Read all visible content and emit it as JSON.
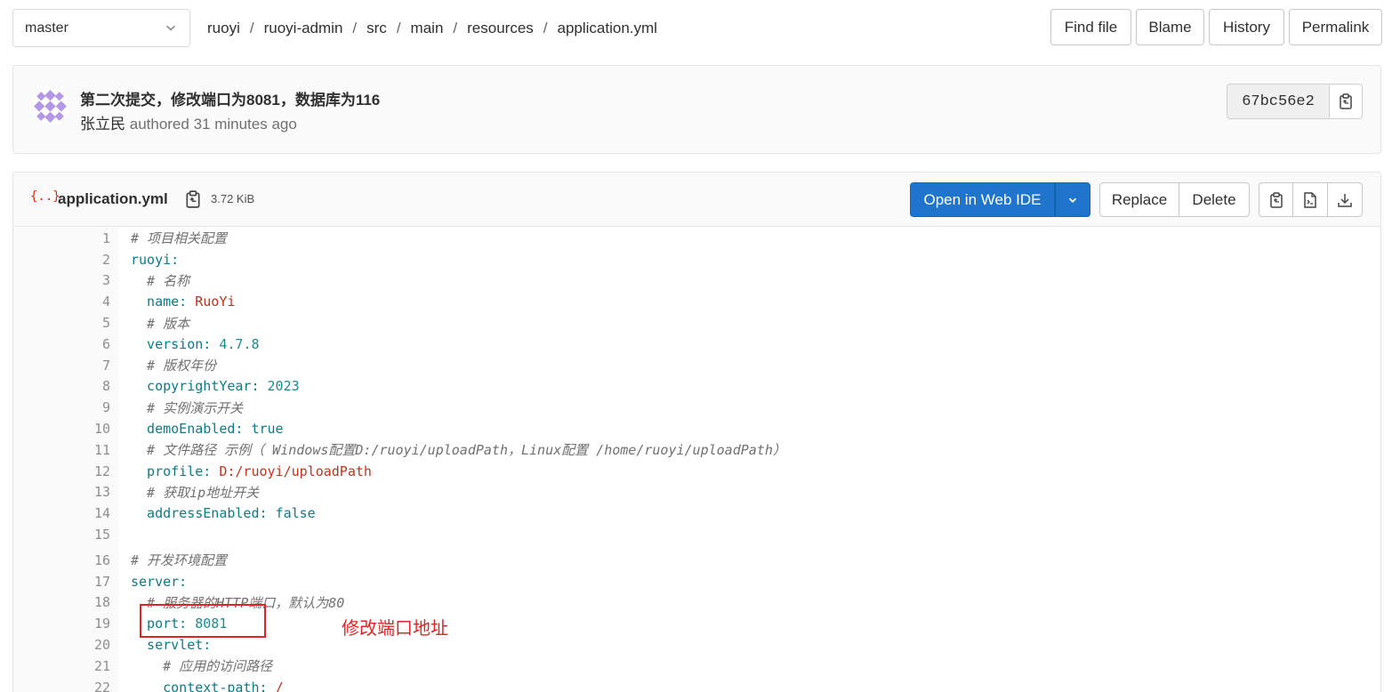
{
  "branch": {
    "value": "master"
  },
  "breadcrumb": [
    "ruoyi",
    "ruoyi-admin",
    "src",
    "main",
    "resources",
    "application.yml"
  ],
  "breadcrumb_sep": "/",
  "top_actions": {
    "find_file": "Find file",
    "blame": "Blame",
    "history": "History",
    "permalink": "Permalink"
  },
  "commit": {
    "title": "第二次提交，修改端口为8081，数据库为116",
    "author": "张立民",
    "meta": "authored 31 minutes ago",
    "sha": "67bc56e2"
  },
  "file": {
    "type_icon": "{..}",
    "name": "application.yml",
    "size": "3.72 KiB",
    "open_ide": "Open in Web IDE",
    "replace": "Replace",
    "delete": "Delete"
  },
  "code_lines": [
    {
      "n": "1",
      "text": "# 项目相关配置"
    },
    {
      "n": "2",
      "text": "ruoyi:"
    },
    {
      "n": "3",
      "text": "  # 名称"
    },
    {
      "n": "4",
      "text": "  name: RuoYi"
    },
    {
      "n": "5",
      "text": "  # 版本"
    },
    {
      "n": "6",
      "text": "  version: 4.7.8"
    },
    {
      "n": "7",
      "text": "  # 版权年份"
    },
    {
      "n": "8",
      "text": "  copyrightYear: 2023"
    },
    {
      "n": "9",
      "text": "  # 实例演示开关"
    },
    {
      "n": "10",
      "text": "  demoEnabled: true"
    },
    {
      "n": "11",
      "text": "  # 文件路径 示例（ Windows配置D:/ruoyi/uploadPath，Linux配置 /home/ruoyi/uploadPath）"
    },
    {
      "n": "12",
      "text": "  profile: D:/ruoyi/uploadPath"
    },
    {
      "n": "13",
      "text": "  # 获取ip地址开关"
    },
    {
      "n": "14",
      "text": "  addressEnabled: false"
    },
    {
      "n": "15",
      "text": ""
    },
    {
      "n": "16",
      "text": "# 开发环境配置"
    },
    {
      "n": "17",
      "text": "server:"
    },
    {
      "n": "18",
      "text": "  # 服务器的HTTP端口，默认为80"
    },
    {
      "n": "19",
      "text": "  port: 8081"
    },
    {
      "n": "20",
      "text": "  servlet:"
    },
    {
      "n": "21",
      "text": "    # 应用的访问路径"
    },
    {
      "n": "22",
      "text": "    context-path: /"
    }
  ],
  "annotation": {
    "text": "修改端口地址"
  },
  "colors": {
    "primary": "#1f75cb",
    "annotation": "#e02424"
  },
  "icons": [
    "chevron-down-icon",
    "avatar-identicon",
    "copy-icon",
    "file-code-icon",
    "raw-icon",
    "download-icon"
  ]
}
